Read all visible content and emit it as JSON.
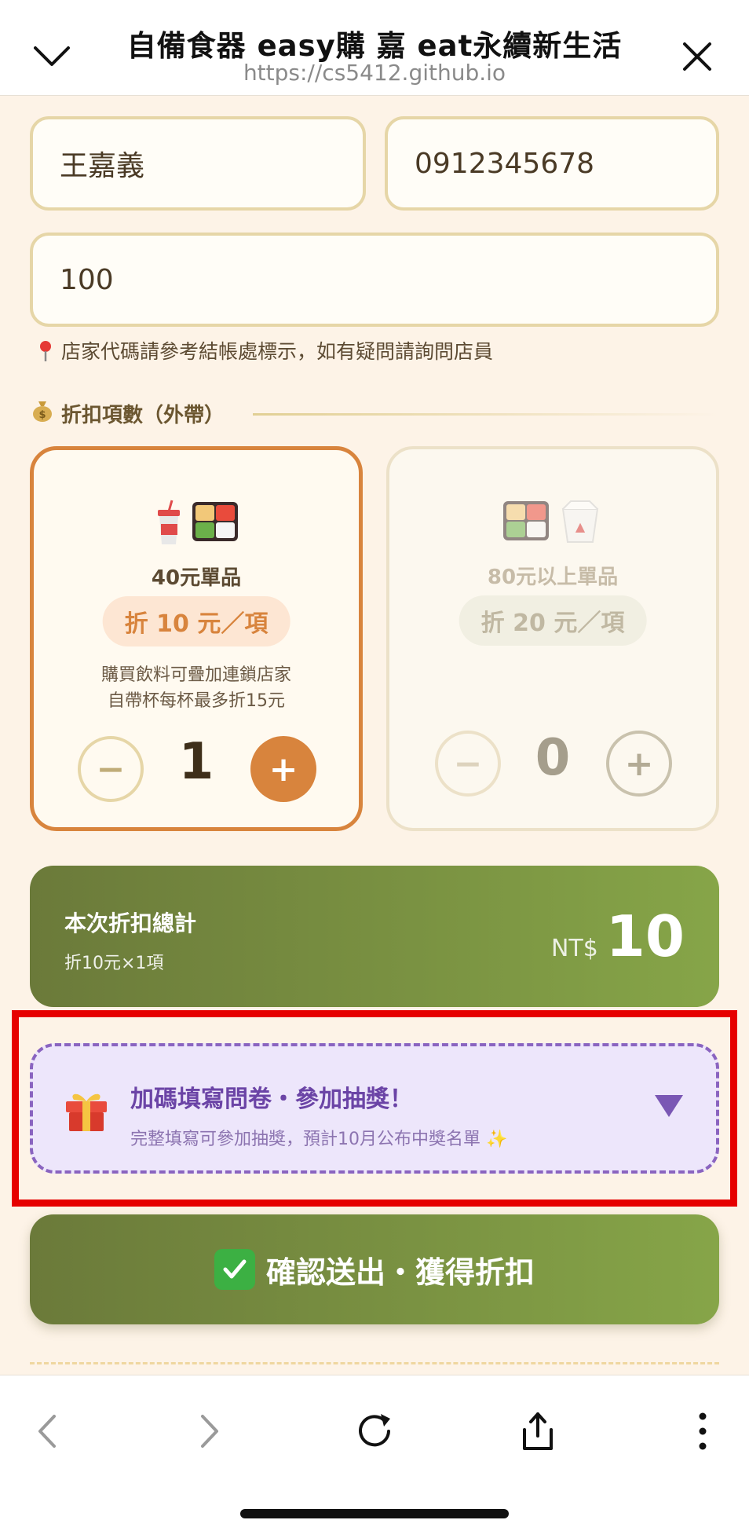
{
  "header": {
    "title": "自備食器 easy購 嘉 eat永續新生活",
    "url": "https://cs5412.github.io"
  },
  "form": {
    "name_value": "王嘉義",
    "phone_value": "0912345678",
    "store_code_value": "100",
    "hint": "店家代碼請參考結帳處標示，如有疑問請詢問店員"
  },
  "discount": {
    "section_title": "折扣項數（外帶）",
    "cards": [
      {
        "name": "40元單品",
        "badge": "折 10 元／項",
        "desc_line1": "購買飲料可疊加連鎖店家",
        "desc_line2": "自帶杯每杯最多折15元",
        "qty": "1",
        "minus": "−",
        "plus": "+"
      },
      {
        "name": "80元以上單品",
        "badge": "折 20 元／項",
        "qty": "0",
        "minus": "−",
        "plus": "+"
      }
    ]
  },
  "total": {
    "label": "本次折扣總計",
    "sub": "折10元×1項",
    "currency": "NT$",
    "amount": "10"
  },
  "survey": {
    "title": "加碼填寫問卷・參加抽獎！",
    "sub": "完整填寫可參加抽獎，預計10月公布中獎名單 ✨"
  },
  "submit": {
    "label": "確認送出・獲得折扣"
  },
  "colors": {
    "accent_orange": "#d8843d",
    "accent_green": "#7a9440",
    "survey_purple": "#6b44a6",
    "highlight_red": "#e60000"
  }
}
